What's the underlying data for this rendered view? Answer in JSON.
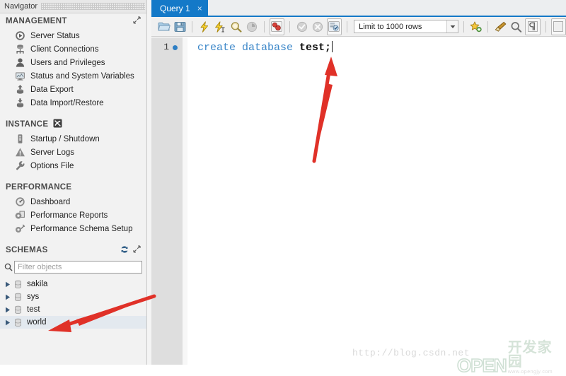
{
  "app": {
    "navigator_title": "Navigator"
  },
  "navigator": {
    "sections": [
      {
        "title": "MANAGEMENT",
        "header_icons": [
          "expand-icon"
        ],
        "items": [
          {
            "label": "Server Status",
            "icon": "server-status-icon"
          },
          {
            "label": "Client Connections",
            "icon": "client-connections-icon"
          },
          {
            "label": "Users and Privileges",
            "icon": "users-privileges-icon"
          },
          {
            "label": "Status and System Variables",
            "icon": "status-variables-icon"
          },
          {
            "label": "Data Export",
            "icon": "data-export-icon"
          },
          {
            "label": "Data Import/Restore",
            "icon": "data-import-icon"
          }
        ]
      },
      {
        "title": "INSTANCE",
        "header_icons": [
          "instance-icon"
        ],
        "items": [
          {
            "label": "Startup / Shutdown",
            "icon": "startup-shutdown-icon"
          },
          {
            "label": "Server Logs",
            "icon": "server-logs-icon"
          },
          {
            "label": "Options File",
            "icon": "options-file-icon"
          }
        ]
      },
      {
        "title": "PERFORMANCE",
        "header_icons": [],
        "items": [
          {
            "label": "Dashboard",
            "icon": "dashboard-icon"
          },
          {
            "label": "Performance Reports",
            "icon": "performance-reports-icon"
          },
          {
            "label": "Performance Schema Setup",
            "icon": "performance-schema-icon"
          }
        ]
      }
    ],
    "schemas_section": {
      "title": "SCHEMAS",
      "header_icons": [
        "refresh-icon",
        "expand-icon"
      ],
      "filter": {
        "placeholder": "Filter objects",
        "value": "",
        "icon": "search-icon"
      },
      "items": [
        {
          "label": "sakila",
          "selected": false
        },
        {
          "label": "sys",
          "selected": false
        },
        {
          "label": "test",
          "selected": false
        },
        {
          "label": "world",
          "selected": true
        }
      ]
    }
  },
  "query": {
    "tabs": [
      {
        "label": "Query 1",
        "active": true,
        "close_label": "×"
      }
    ],
    "toolbar": {
      "buttons": [
        {
          "name": "open-script-icon",
          "glyph": "folder"
        },
        {
          "name": "save-script-icon",
          "glyph": "disk"
        },
        {
          "name": "execute-statement-icon",
          "glyph": "bolt"
        },
        {
          "name": "execute-current-statement-icon",
          "glyph": "bolt-cursor"
        },
        {
          "name": "explain-statement-icon",
          "glyph": "magnifier-doc"
        },
        {
          "name": "stop-execution-icon",
          "glyph": "stop-clock"
        },
        {
          "name": "toggle-query-analysis-icon",
          "glyph": "analysis"
        },
        {
          "name": "commit-icon",
          "glyph": "check"
        },
        {
          "name": "rollback-icon",
          "glyph": "cancel"
        },
        {
          "name": "autocommit-icon",
          "glyph": "autocommit"
        }
      ],
      "limit_select": {
        "label": "Limit to 1000 rows",
        "arrow": "▾"
      },
      "right_buttons": [
        {
          "name": "add-snippet-icon",
          "glyph": "star-add"
        },
        {
          "name": "beautify-query-icon",
          "glyph": "broom"
        },
        {
          "name": "find-icon",
          "glyph": "magnifier"
        },
        {
          "name": "toggle-invisible-chars-icon",
          "glyph": "pilcrow"
        }
      ]
    },
    "editor": {
      "line_number": "1",
      "sql_keyword": "create database",
      "sql_identifier": "test;"
    }
  },
  "watermark": {
    "url": "http://blog.csdn.net",
    "logo_text": "OPEN",
    "logo_cn": "开发家园",
    "logo_site": "www.opengjy.com"
  },
  "annotations": {
    "arrows": [
      {
        "name": "arrow-to-sql-statement",
        "color": "#e03128"
      },
      {
        "name": "arrow-to-test-schema",
        "color": "#e03128"
      }
    ]
  },
  "colors": {
    "accent": "#1479c8",
    "sidebar_bg": "#f2f2f2",
    "gutter_bg": "#dedede",
    "arrow_red": "#e03128",
    "keyword_blue": "#3a86c8"
  }
}
